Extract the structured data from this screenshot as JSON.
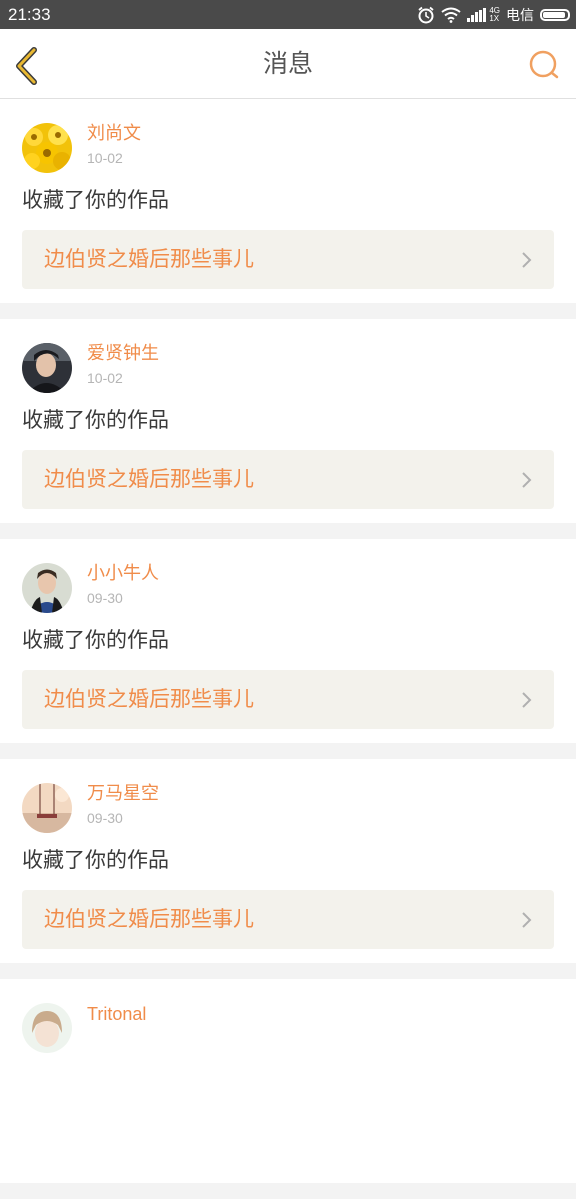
{
  "status_bar": {
    "time": "21:33",
    "network_top": "4G",
    "network_bottom": "1X",
    "carrier": "电信",
    "battery_level": 0.9
  },
  "header": {
    "title": "消息",
    "back_icon": "chevron-left-icon",
    "search_icon": "search-icon"
  },
  "colors": {
    "accent": "#f08c4a",
    "back_icon": "#e8b832",
    "card_link_bg": "#f3f2ec",
    "page_bg": "#f3f3f3",
    "status_bar_bg": "#4a4a4a"
  },
  "messages": [
    {
      "user": "刘尚文",
      "date": "10-02",
      "action": "收藏了你的作品",
      "work": "边伯贤之婚后那些事儿"
    },
    {
      "user": "爱贤钟生",
      "date": "10-02",
      "action": "收藏了你的作品",
      "work": "边伯贤之婚后那些事儿"
    },
    {
      "user": "小小牛人",
      "date": "09-30",
      "action": "收藏了你的作品",
      "work": "边伯贤之婚后那些事儿"
    },
    {
      "user": "万马星空",
      "date": "09-30",
      "action": "收藏了你的作品",
      "work": "边伯贤之婚后那些事儿"
    },
    {
      "user": "Tritonal",
      "date": "",
      "action": "",
      "work": ""
    }
  ]
}
